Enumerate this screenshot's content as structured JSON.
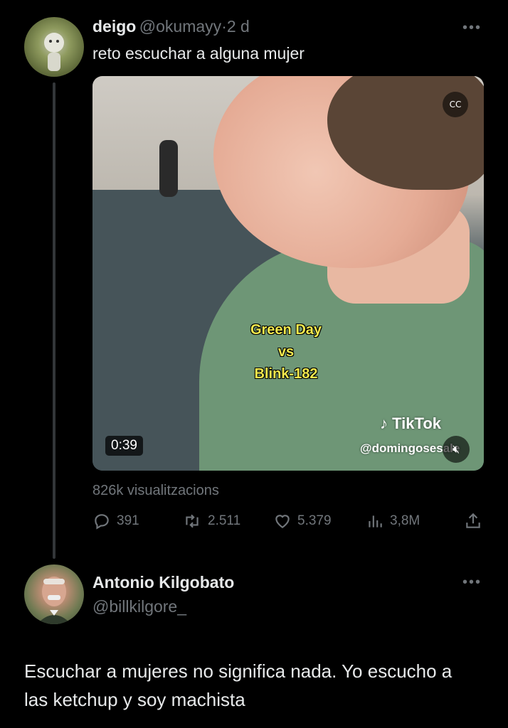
{
  "tweet": {
    "display_name": "deigo",
    "handle": "@okumayy",
    "separator": "·",
    "time": "2 d",
    "text": "reto escuchar a alguna mujer",
    "more_icon": "more-horizontal-icon",
    "media": {
      "caption_lines": [
        "Green Day",
        "vs",
        "Blink-182"
      ],
      "duration": "0:39",
      "watermark_brand": "TikTok",
      "watermark_handle": "@domingosesale",
      "cc_icon": "closed-captions-off-icon",
      "mute_icon": "mute-icon"
    },
    "views": "826k visualitzacions",
    "actions": {
      "replies": "391",
      "retweets": "2.511",
      "likes": "5.379",
      "view_count": "3,8M"
    }
  },
  "reply": {
    "display_name": "Antonio Kilgobato",
    "handle": "@billkilgore_",
    "text": "Escuchar a mujeres no significa nada. Yo escucho a las ketchup y soy machista"
  },
  "colors": {
    "background": "#000000",
    "text_primary": "#e7e9ea",
    "text_muted": "#71767b",
    "caption_yellow": "#f3e94d"
  }
}
